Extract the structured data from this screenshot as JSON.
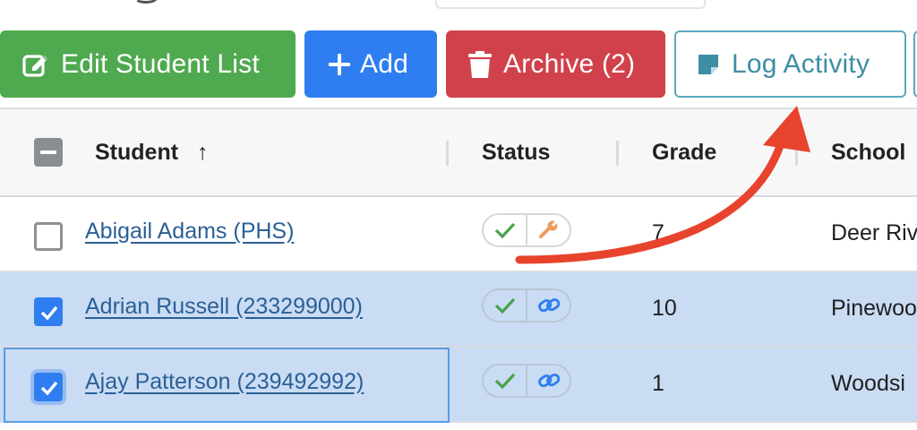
{
  "toolbar": {
    "edit_label": "Edit Student List",
    "add_label": "Add",
    "archive_label": "Archive (2)",
    "log_label": "Log Activity"
  },
  "table": {
    "columns": {
      "student": "Student",
      "status": "Status",
      "grade": "Grade",
      "school": "School"
    },
    "sort_indicator": "↑",
    "rows": [
      {
        "name": "Abigail Adams (PHS)",
        "grade": "7",
        "school": "Deer Riv",
        "checked": false,
        "second_icon": "wrench-icon"
      },
      {
        "name": "Adrian Russell (233299000)",
        "grade": "10",
        "school": "Pinewoo",
        "checked": true,
        "second_icon": "link-icon"
      },
      {
        "name": "Ajay Patterson (239492992)",
        "grade": "1",
        "school": "Woodsi",
        "checked": true,
        "second_icon": "link-icon"
      }
    ]
  },
  "colors": {
    "edit": "#4fa94f",
    "add": "#2f7ef1",
    "archive": "#d1414b",
    "log_border": "#5ba9bd",
    "selected_row": "#c9dcf3",
    "annotation_arrow": "#e8432d"
  },
  "icons": {
    "edit": "edit-icon",
    "add": "plus-icon",
    "archive": "trash-icon",
    "log": "note-icon",
    "status_ok": "check-icon"
  }
}
